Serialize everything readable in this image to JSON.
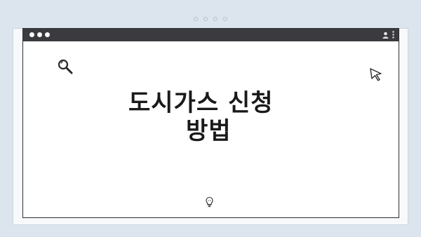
{
  "window": {
    "title_lines": [
      "도시가스 신청",
      "방법"
    ]
  },
  "icons": {
    "search": "search-icon",
    "cursor": "cursor-arrow-icon",
    "bulb": "lightbulb-icon",
    "user": "user-icon",
    "menu": "kebab-menu-icon"
  },
  "colors": {
    "background": "#dce4ed",
    "titlebar": "#3b3b3f",
    "page": "#ffffff",
    "text": "#1a1a1a"
  }
}
